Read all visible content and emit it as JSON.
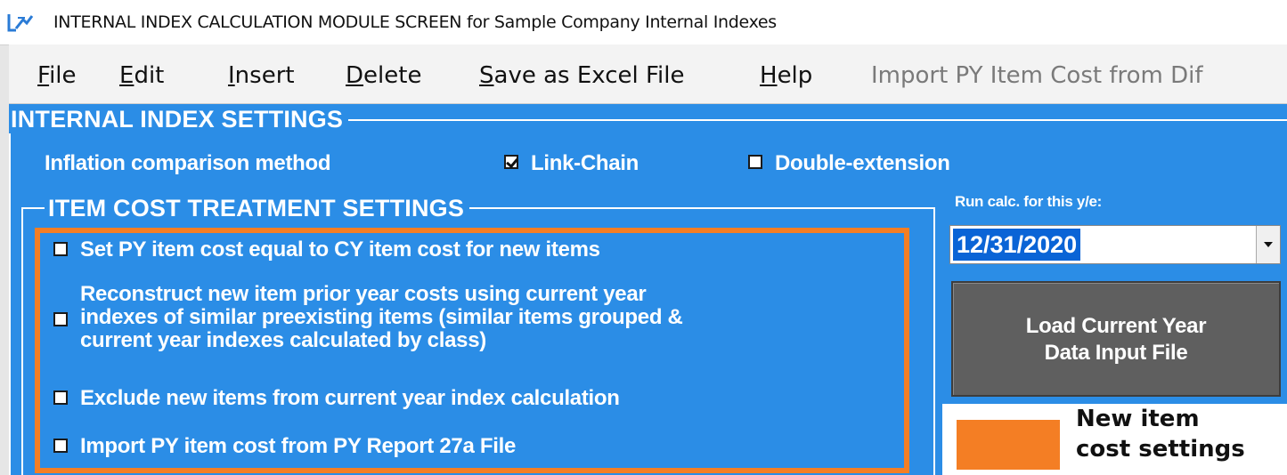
{
  "window": {
    "title": "INTERNAL INDEX CALCULATION MODULE SCREEN for   Sample Company Internal Indexes"
  },
  "menu": {
    "items": [
      {
        "label": "File",
        "accel": "F",
        "rest": "ile",
        "enabled": true
      },
      {
        "label": "Edit",
        "accel": "E",
        "rest": "dit",
        "enabled": true
      },
      {
        "label": "Insert",
        "accel": "I",
        "rest": "nsert",
        "enabled": true
      },
      {
        "label": "Delete",
        "accel": "D",
        "rest": "elete",
        "enabled": true
      },
      {
        "label": "Save as Excel File",
        "accel": "S",
        "rest": "ave as Excel File",
        "enabled": true
      },
      {
        "label": "Help",
        "accel": "H",
        "rest": "elp",
        "enabled": true
      },
      {
        "label": "Import PY Item Cost from Dif",
        "accel": "",
        "rest": "Import PY Item Cost from Dif",
        "enabled": false
      }
    ]
  },
  "index_settings": {
    "title": "INTERNAL INDEX SETTINGS",
    "method_label": "Inflation comparison method",
    "options": [
      {
        "label": "Link-Chain",
        "checked": true
      },
      {
        "label": "Double-extension",
        "checked": false
      }
    ]
  },
  "item_cost": {
    "title": "ITEM COST TREATMENT SETTINGS",
    "options": [
      {
        "label": "Set PY item cost equal to CY item cost for new items",
        "checked": false
      },
      {
        "label": "Reconstruct new item prior year costs using current year\nindexes of similar preexisting items (similar items grouped &\ncurrent year indexes calculated by class)",
        "checked": false
      },
      {
        "label": "Exclude new items from current year index calculation",
        "checked": false
      },
      {
        "label": "Import PY item cost from PY Report 27a File",
        "checked": false
      }
    ]
  },
  "run_calc": {
    "label": "Run calc. for this y/e:",
    "value": "12/31/2020"
  },
  "load_button": {
    "label": "Load Current Year\nData Input File"
  },
  "legend": {
    "swatch_color": "#f47e24",
    "text": "New item\ncost settings"
  },
  "colors": {
    "window_bg": "#2b8de6",
    "highlight": "#f47e24",
    "button_bg": "#5f5f5f"
  }
}
